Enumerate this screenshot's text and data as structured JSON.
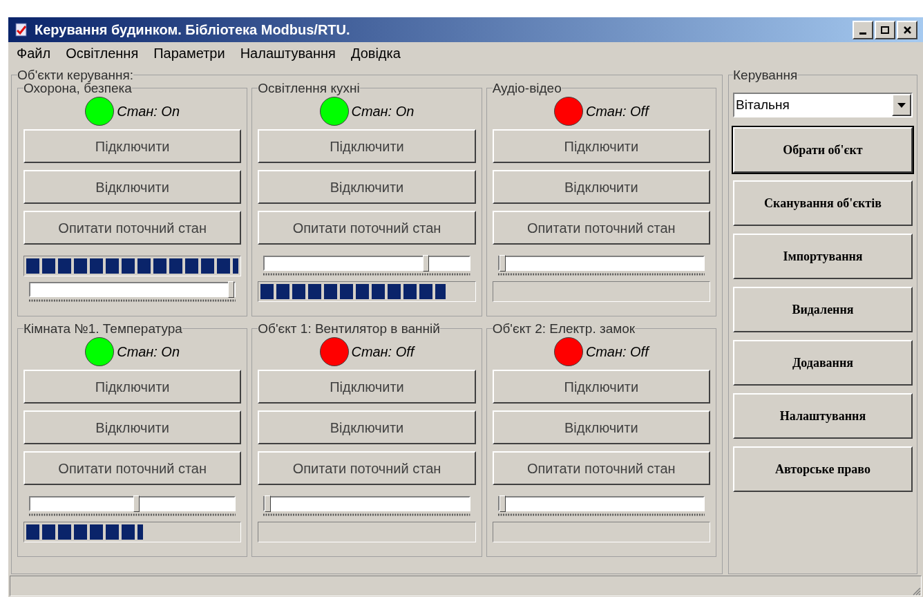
{
  "window": {
    "title": "Керування будинком. Бібліотека Modbus/RTU."
  },
  "menu": [
    "Файл",
    "Освітлення",
    "Параметри",
    "Налаштування",
    "Довідка"
  ],
  "objects_group": {
    "title": "Об'єкти керування:",
    "objects": [
      {
        "title": "Охорона, безпека",
        "on": true,
        "status": "Стан: On",
        "buttons": [
          "Підключити",
          "Відключити",
          "Опитати поточний стан"
        ],
        "controls": [
          {
            "kind": "progress",
            "level": 1
          },
          {
            "kind": "slider",
            "level": 1
          }
        ]
      },
      {
        "title": "Освітлення кухні",
        "on": true,
        "status": "Стан: On",
        "buttons": [
          "Підключити",
          "Відключити",
          "Опитати поточний стан"
        ],
        "controls": [
          {
            "kind": "slider",
            "level": 0.8
          },
          {
            "kind": "progress",
            "level": 0.87
          }
        ]
      },
      {
        "title": "Аудіо-відео",
        "on": false,
        "status": "Стан: Off",
        "buttons": [
          "Підключити",
          "Відключити",
          "Опитати поточний стан"
        ],
        "controls": [
          {
            "kind": "slider",
            "level": 0
          },
          {
            "kind": "progress",
            "level": 0
          }
        ]
      },
      {
        "title": "Кімната №1. Температура",
        "on": true,
        "status": "Стан: On",
        "buttons": [
          "Підключити",
          "Відключити",
          "Опитати поточний стан"
        ],
        "controls": [
          {
            "kind": "slider",
            "level": 0.52
          },
          {
            "kind": "progress",
            "level": 0.55
          }
        ]
      },
      {
        "title": "Об'єкт 1: Вентилятор в ванній",
        "on": false,
        "status": "Стан: Off",
        "buttons": [
          "Підключити",
          "Відключити",
          "Опитати поточний стан"
        ],
        "controls": [
          {
            "kind": "slider",
            "level": 0
          },
          {
            "kind": "progress",
            "level": 0
          }
        ]
      },
      {
        "title": "Об'єкт 2: Електр. замок",
        "on": false,
        "status": "Стан: Off",
        "buttons": [
          "Підключити",
          "Відключити",
          "Опитати поточний стан"
        ],
        "controls": [
          {
            "kind": "slider",
            "level": 0
          },
          {
            "kind": "progress",
            "level": 0
          }
        ]
      }
    ]
  },
  "control_group": {
    "title": "Керування",
    "dropdown": {
      "value": "Вітальня"
    },
    "buttons": [
      {
        "label": "Обрати об'єкт",
        "focused": true
      },
      {
        "label": "Сканування об'єктів",
        "focused": false
      },
      {
        "label": "Імпортування",
        "focused": false
      },
      {
        "label": "Видалення",
        "focused": false
      },
      {
        "label": "Додавання",
        "focused": false
      },
      {
        "label": "Налаштування",
        "focused": false
      },
      {
        "label": "Авторське право",
        "focused": false
      }
    ]
  }
}
